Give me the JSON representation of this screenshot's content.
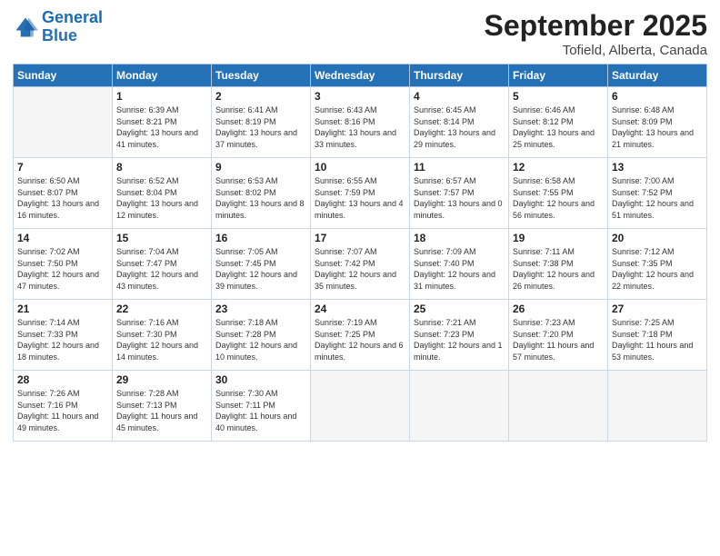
{
  "header": {
    "logo_line1": "General",
    "logo_line2": "Blue",
    "month": "September 2025",
    "location": "Tofield, Alberta, Canada"
  },
  "weekdays": [
    "Sunday",
    "Monday",
    "Tuesday",
    "Wednesday",
    "Thursday",
    "Friday",
    "Saturday"
  ],
  "weeks": [
    [
      {
        "day": "",
        "empty": true
      },
      {
        "day": "1",
        "sunrise": "6:39 AM",
        "sunset": "8:21 PM",
        "daylight": "13 hours and 41 minutes."
      },
      {
        "day": "2",
        "sunrise": "6:41 AM",
        "sunset": "8:19 PM",
        "daylight": "13 hours and 37 minutes."
      },
      {
        "day": "3",
        "sunrise": "6:43 AM",
        "sunset": "8:16 PM",
        "daylight": "13 hours and 33 minutes."
      },
      {
        "day": "4",
        "sunrise": "6:45 AM",
        "sunset": "8:14 PM",
        "daylight": "13 hours and 29 minutes."
      },
      {
        "day": "5",
        "sunrise": "6:46 AM",
        "sunset": "8:12 PM",
        "daylight": "13 hours and 25 minutes."
      },
      {
        "day": "6",
        "sunrise": "6:48 AM",
        "sunset": "8:09 PM",
        "daylight": "13 hours and 21 minutes."
      }
    ],
    [
      {
        "day": "7",
        "sunrise": "6:50 AM",
        "sunset": "8:07 PM",
        "daylight": "13 hours and 16 minutes."
      },
      {
        "day": "8",
        "sunrise": "6:52 AM",
        "sunset": "8:04 PM",
        "daylight": "13 hours and 12 minutes."
      },
      {
        "day": "9",
        "sunrise": "6:53 AM",
        "sunset": "8:02 PM",
        "daylight": "13 hours and 8 minutes."
      },
      {
        "day": "10",
        "sunrise": "6:55 AM",
        "sunset": "7:59 PM",
        "daylight": "13 hours and 4 minutes."
      },
      {
        "day": "11",
        "sunrise": "6:57 AM",
        "sunset": "7:57 PM",
        "daylight": "13 hours and 0 minutes."
      },
      {
        "day": "12",
        "sunrise": "6:58 AM",
        "sunset": "7:55 PM",
        "daylight": "12 hours and 56 minutes."
      },
      {
        "day": "13",
        "sunrise": "7:00 AM",
        "sunset": "7:52 PM",
        "daylight": "12 hours and 51 minutes."
      }
    ],
    [
      {
        "day": "14",
        "sunrise": "7:02 AM",
        "sunset": "7:50 PM",
        "daylight": "12 hours and 47 minutes."
      },
      {
        "day": "15",
        "sunrise": "7:04 AM",
        "sunset": "7:47 PM",
        "daylight": "12 hours and 43 minutes."
      },
      {
        "day": "16",
        "sunrise": "7:05 AM",
        "sunset": "7:45 PM",
        "daylight": "12 hours and 39 minutes."
      },
      {
        "day": "17",
        "sunrise": "7:07 AM",
        "sunset": "7:42 PM",
        "daylight": "12 hours and 35 minutes."
      },
      {
        "day": "18",
        "sunrise": "7:09 AM",
        "sunset": "7:40 PM",
        "daylight": "12 hours and 31 minutes."
      },
      {
        "day": "19",
        "sunrise": "7:11 AM",
        "sunset": "7:38 PM",
        "daylight": "12 hours and 26 minutes."
      },
      {
        "day": "20",
        "sunrise": "7:12 AM",
        "sunset": "7:35 PM",
        "daylight": "12 hours and 22 minutes."
      }
    ],
    [
      {
        "day": "21",
        "sunrise": "7:14 AM",
        "sunset": "7:33 PM",
        "daylight": "12 hours and 18 minutes."
      },
      {
        "day": "22",
        "sunrise": "7:16 AM",
        "sunset": "7:30 PM",
        "daylight": "12 hours and 14 minutes."
      },
      {
        "day": "23",
        "sunrise": "7:18 AM",
        "sunset": "7:28 PM",
        "daylight": "12 hours and 10 minutes."
      },
      {
        "day": "24",
        "sunrise": "7:19 AM",
        "sunset": "7:25 PM",
        "daylight": "12 hours and 6 minutes."
      },
      {
        "day": "25",
        "sunrise": "7:21 AM",
        "sunset": "7:23 PM",
        "daylight": "12 hours and 1 minute."
      },
      {
        "day": "26",
        "sunrise": "7:23 AM",
        "sunset": "7:20 PM",
        "daylight": "11 hours and 57 minutes."
      },
      {
        "day": "27",
        "sunrise": "7:25 AM",
        "sunset": "7:18 PM",
        "daylight": "11 hours and 53 minutes."
      }
    ],
    [
      {
        "day": "28",
        "sunrise": "7:26 AM",
        "sunset": "7:16 PM",
        "daylight": "11 hours and 49 minutes."
      },
      {
        "day": "29",
        "sunrise": "7:28 AM",
        "sunset": "7:13 PM",
        "daylight": "11 hours and 45 minutes."
      },
      {
        "day": "30",
        "sunrise": "7:30 AM",
        "sunset": "7:11 PM",
        "daylight": "11 hours and 40 minutes."
      },
      {
        "day": "",
        "empty": true
      },
      {
        "day": "",
        "empty": true
      },
      {
        "day": "",
        "empty": true
      },
      {
        "day": "",
        "empty": true
      }
    ]
  ]
}
